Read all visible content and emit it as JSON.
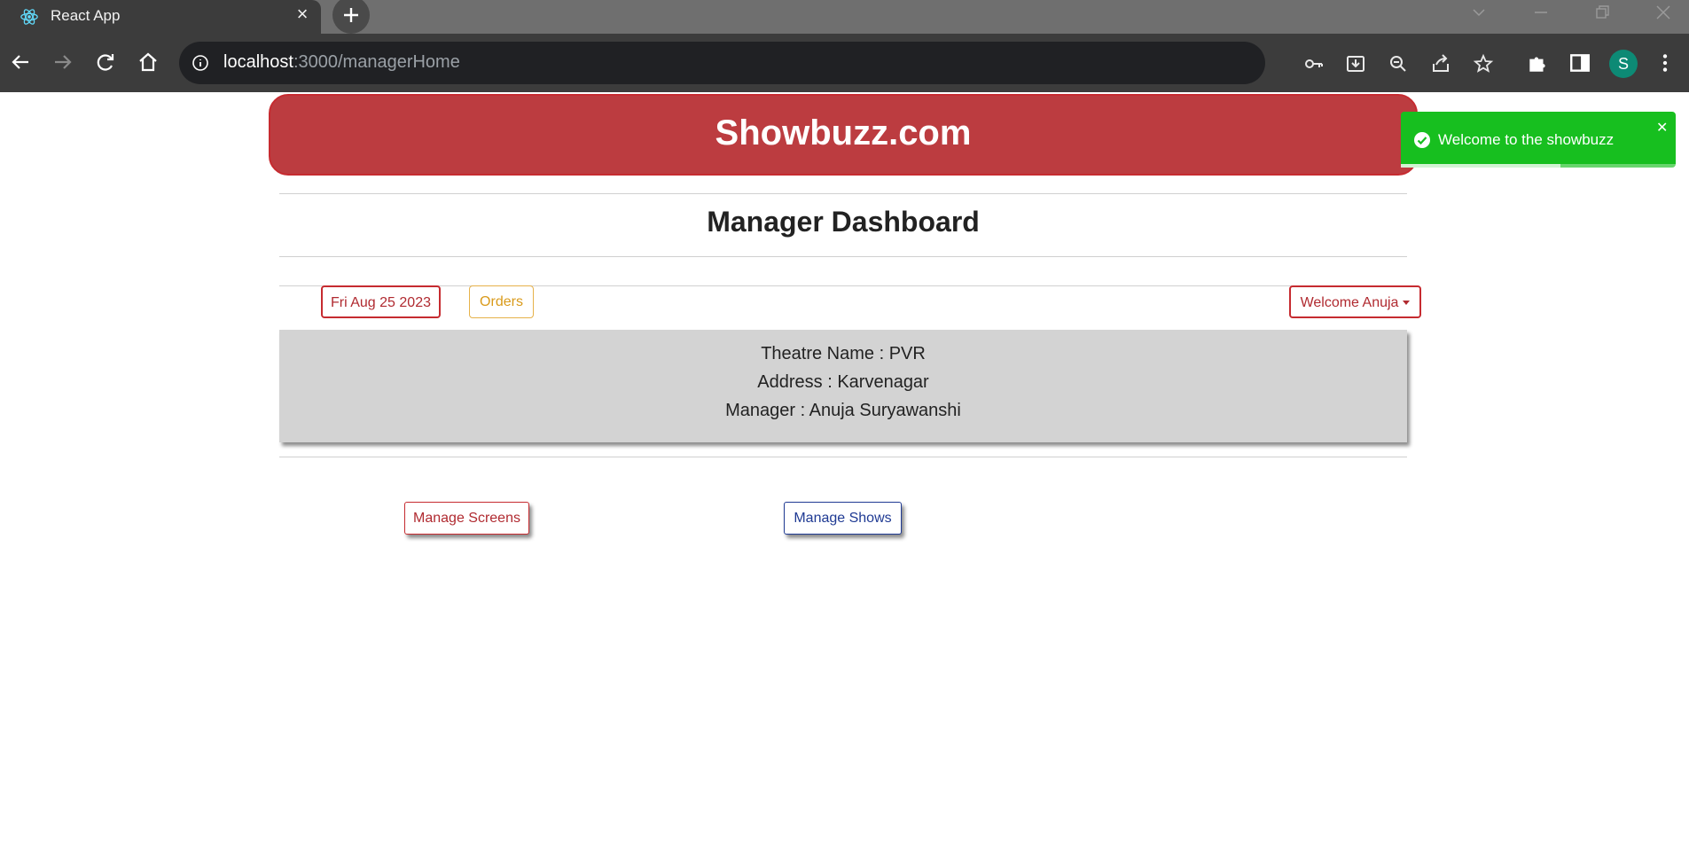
{
  "browser": {
    "tab_title": "React App",
    "url_host": "localhost",
    "url_path": ":3000/managerHome",
    "profile_initial": "S"
  },
  "header": {
    "brand": "Showbuzz.com"
  },
  "dashboard": {
    "title": "Manager Dashboard",
    "date_label": "Fri Aug 25 2023",
    "orders_label": "Orders",
    "welcome_label": "Welcome Anuja"
  },
  "theatre": {
    "name_line": "Theatre Name : PVR",
    "address_line": "Address : Karvenagar",
    "manager_line": "Manager : Anuja Suryawanshi"
  },
  "actions": {
    "manage_screens": "Manage Screens",
    "manage_shows": "Manage Shows"
  },
  "toast": {
    "message": "Welcome to the showbuzz",
    "progress": 0.58
  },
  "colors": {
    "brand_red": "#bc3c40",
    "toast_green": "#17bf1f",
    "card_gray": "#d3d3d3",
    "shows_blue": "#1f3a93"
  }
}
